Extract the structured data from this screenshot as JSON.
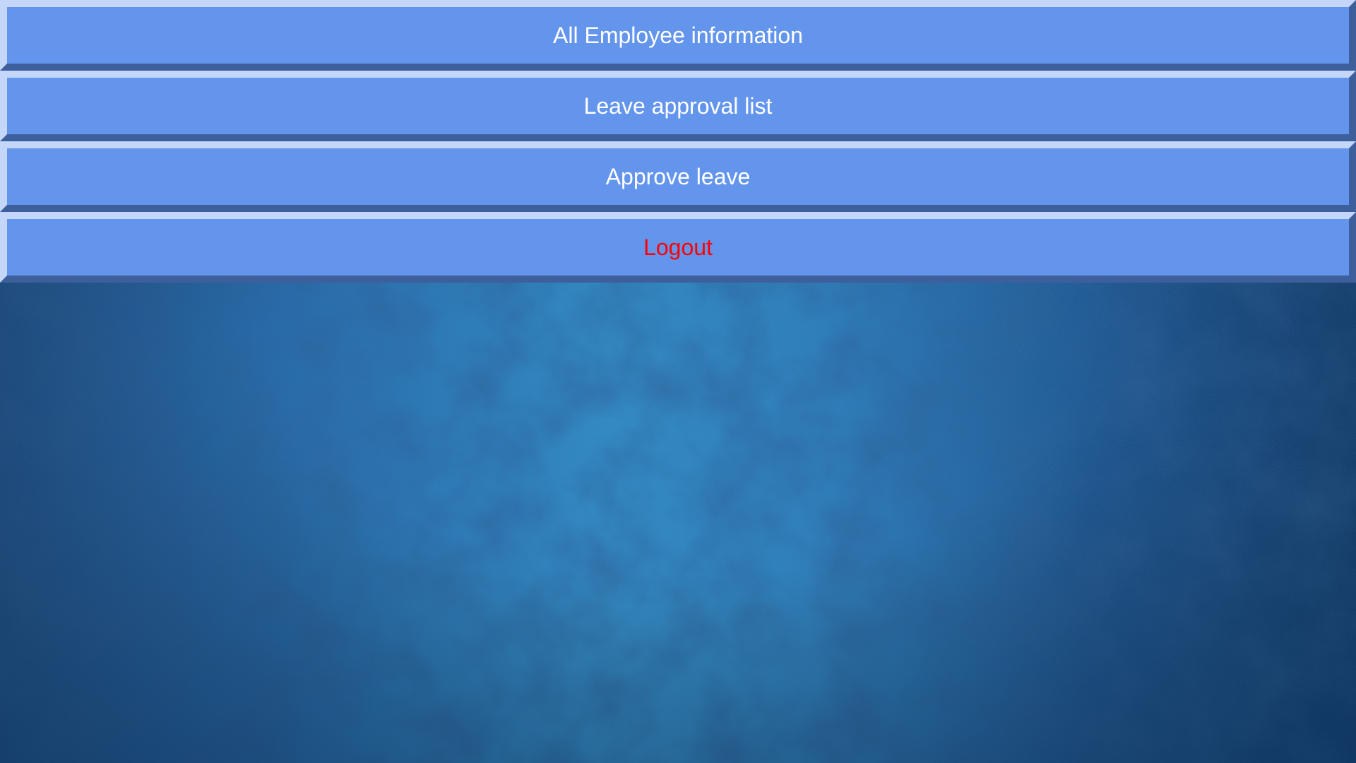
{
  "menu": {
    "items": [
      {
        "label": "All Employee information"
      },
      {
        "label": "Leave approval list"
      },
      {
        "label": "Approve leave"
      },
      {
        "label": "Logout"
      }
    ]
  },
  "colors": {
    "button_bg": "#6495ed",
    "button_text": "#ffffff",
    "logout_text": "#ff0000",
    "background": "#1a5a96"
  }
}
